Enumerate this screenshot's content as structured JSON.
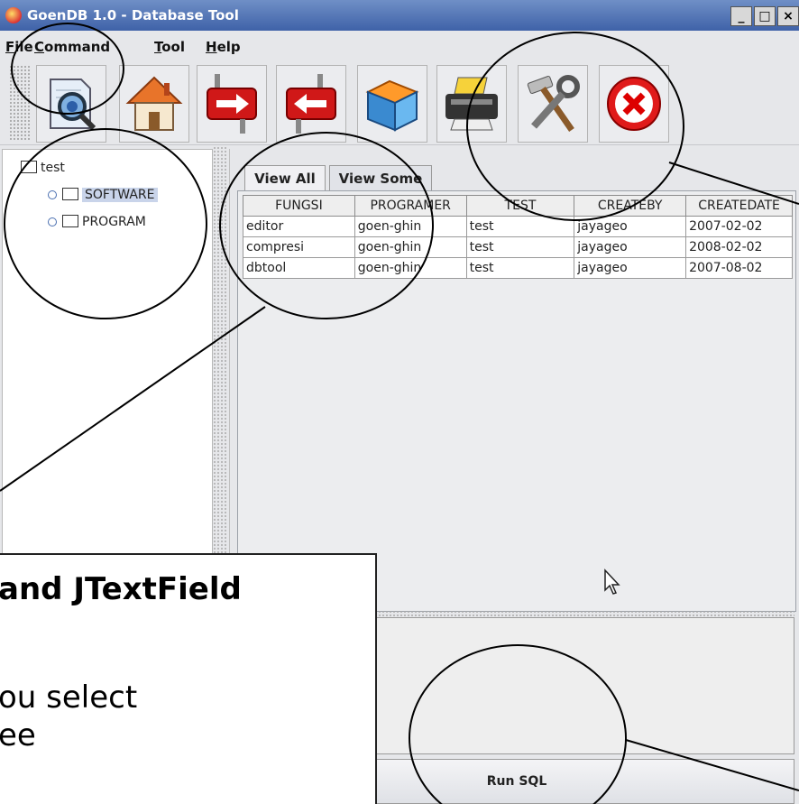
{
  "window": {
    "title": "GoenDB 1.0 - Database Tool",
    "min": "_",
    "max": "□",
    "close": "×"
  },
  "menu": [
    {
      "key": "F",
      "rest": "ile"
    },
    {
      "key": "C",
      "rest": "ommand"
    },
    {
      "key": "T",
      "rest": "ool"
    },
    {
      "key": "H",
      "rest": "elp"
    }
  ],
  "toolbar": {
    "buttons": [
      "search-icon",
      "home-icon",
      "forward-icon",
      "back-icon",
      "box-icon",
      "printer-icon",
      "tools-icon",
      "exit-icon"
    ]
  },
  "tree": {
    "root": "test",
    "children": [
      "SOFTWARE",
      "PROGRAM"
    ]
  },
  "tabs": [
    "View All",
    "View Some"
  ],
  "table": {
    "headers": [
      "FUNGSI",
      "PROGRAMER",
      "TEST",
      "CREATEBY",
      "CREATEDATE"
    ],
    "rows": [
      [
        "editor",
        "goen-ghin",
        "test",
        "jayageo",
        "2007-02-02"
      ],
      [
        "compresi",
        "goen-ghin",
        "test",
        "jayageo",
        "2008-02-02"
      ],
      [
        "dbtool",
        "goen-ghin",
        "test",
        "jayageo",
        "2007-08-02"
      ]
    ]
  },
  "run_button": "Run SQL",
  "callout": {
    "line1": "and JTextField",
    "line2": "ou select",
    "line3": "ee"
  }
}
